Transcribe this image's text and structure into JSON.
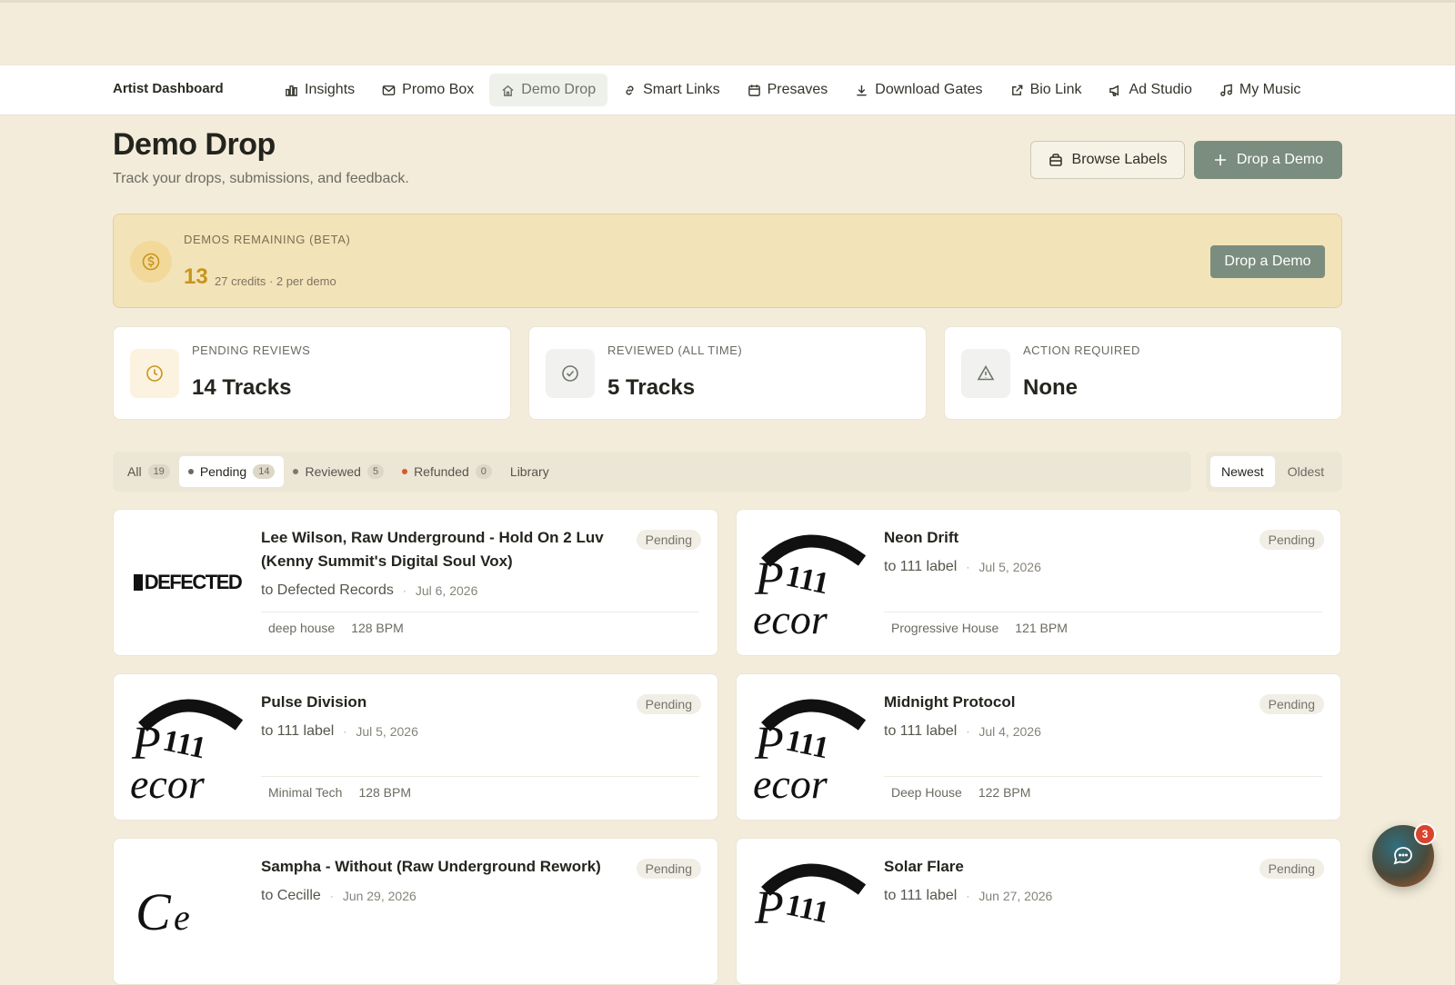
{
  "nav": {
    "brand": "Artist Dashboard",
    "items": [
      {
        "label": "Insights",
        "icon": "bar-chart-icon"
      },
      {
        "label": "Promo Box",
        "icon": "mail-icon"
      },
      {
        "label": "Demo Drop",
        "icon": "home-icon",
        "active": true
      },
      {
        "label": "Smart Links",
        "icon": "link-icon"
      },
      {
        "label": "Presaves",
        "icon": "calendar-icon"
      },
      {
        "label": "Download Gates",
        "icon": "download-icon"
      },
      {
        "label": "Bio Link",
        "icon": "external-link-icon"
      },
      {
        "label": "Ad Studio",
        "icon": "megaphone-icon"
      },
      {
        "label": "My Music",
        "icon": "music-note-icon"
      }
    ]
  },
  "header": {
    "title": "Demo Drop",
    "subtitle": "Track your drops, submissions, and feedback.",
    "browse_label": "Browse Labels",
    "drop_label": "Drop a Demo"
  },
  "credits": {
    "label": "DEMOS REMAINING (BETA)",
    "remaining": "13",
    "detail": "27 credits · 2 per demo",
    "button": "Drop a Demo"
  },
  "stats": [
    {
      "label": "PENDING REVIEWS",
      "value": "14 Tracks"
    },
    {
      "label": "REVIEWED (ALL TIME)",
      "value": "5 Tracks"
    },
    {
      "label": "ACTION REQUIRED",
      "value": "None"
    }
  ],
  "filters": {
    "tabs": [
      {
        "label": "All",
        "count": "19"
      },
      {
        "label": "Pending",
        "count": "14",
        "active": true
      },
      {
        "label": "Reviewed",
        "count": "5"
      },
      {
        "label": "Refunded",
        "count": "0"
      },
      {
        "label": "Library",
        "count": ""
      }
    ],
    "sort": [
      "Newest",
      "Oldest"
    ]
  },
  "demos": [
    {
      "title": "Lee Wilson, Raw Underground - Hold On 2 Luv (Kenny Summit's Digital Soul Vox)",
      "to": "to Defected Records",
      "date": "Jul 6, 2026",
      "genre": "deep house",
      "bpm": "128 BPM",
      "status": "Pending",
      "art": "DEFECTED"
    },
    {
      "title": "Neon Drift",
      "to": "to 111 label",
      "date": "Jul 5, 2026",
      "genre": "Progressive House",
      "bpm": "121 BPM",
      "status": "Pending",
      "art": "111"
    },
    {
      "title": "Pulse Division",
      "to": "to 111 label",
      "date": "Jul 5, 2026",
      "genre": "Minimal Tech",
      "bpm": "128 BPM",
      "status": "Pending",
      "art": "111"
    },
    {
      "title": "Midnight Protocol",
      "to": "to 111 label",
      "date": "Jul 4, 2026",
      "genre": "Deep House",
      "bpm": "122 BPM",
      "status": "Pending",
      "art": "111"
    },
    {
      "title": "Sampha - Without (Raw Underground Rework)",
      "to": "to Cecille",
      "date": "Jun 29, 2026",
      "genre": "",
      "bpm": "",
      "status": "Pending",
      "art": "cecille"
    },
    {
      "title": "Solar Flare",
      "to": "to 111 label",
      "date": "Jun 27, 2026",
      "genre": "",
      "bpm": "",
      "status": "Pending",
      "art": "111"
    }
  ],
  "chat": {
    "badge": "3"
  },
  "colors": {
    "accent": "#7b8d7e",
    "background": "#f3ecda",
    "credits_bg": "#f3e3b8",
    "credits_num": "#c9941d",
    "refunded_dot": "#d9582e"
  }
}
